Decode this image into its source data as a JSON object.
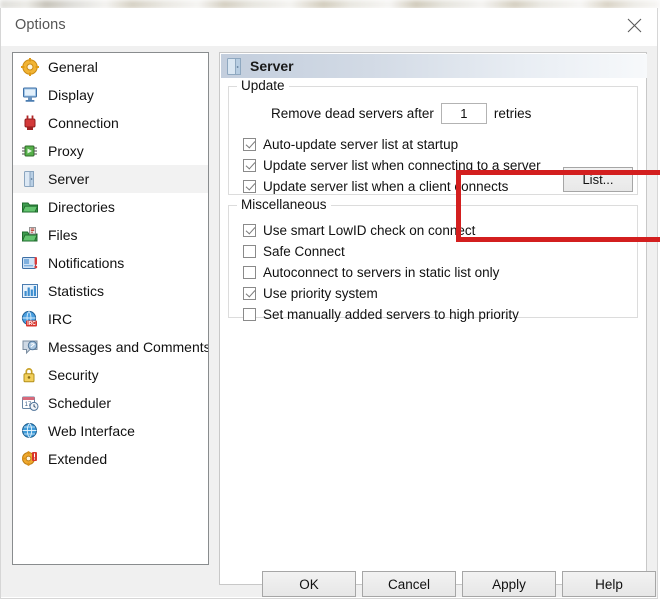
{
  "window": {
    "title": "Options",
    "close_icon": "close-icon"
  },
  "sidebar": {
    "items": [
      {
        "label": "General",
        "icon": "gear-icon",
        "selected": false
      },
      {
        "label": "Display",
        "icon": "monitor-icon",
        "selected": false
      },
      {
        "label": "Connection",
        "icon": "plug-icon",
        "selected": false
      },
      {
        "label": "Proxy",
        "icon": "proxy-icon",
        "selected": false
      },
      {
        "label": "Server",
        "icon": "server-door-icon",
        "selected": true
      },
      {
        "label": "Directories",
        "icon": "folder-green-icon",
        "selected": false
      },
      {
        "label": "Files",
        "icon": "files-icon",
        "selected": false
      },
      {
        "label": "Notifications",
        "icon": "notification-icon",
        "selected": false
      },
      {
        "label": "Statistics",
        "icon": "chart-bars-icon",
        "selected": false
      },
      {
        "label": "IRC",
        "icon": "irc-globe-icon",
        "selected": false
      },
      {
        "label": "Messages and Comments",
        "icon": "speech-bubble-icon",
        "selected": false
      },
      {
        "label": "Security",
        "icon": "padlock-icon",
        "selected": false
      },
      {
        "label": "Scheduler",
        "icon": "calendar-clock-icon",
        "selected": false
      },
      {
        "label": "Web Interface",
        "icon": "globe-icon",
        "selected": false
      },
      {
        "label": "Extended",
        "icon": "gear-alert-icon",
        "selected": false
      }
    ]
  },
  "panel": {
    "header": {
      "title": "Server",
      "icon": "server-door-icon"
    },
    "update_group": {
      "legend": "Update",
      "retries_prefix": "Remove dead servers after",
      "retries_value": "1",
      "retries_suffix": "retries",
      "list_button": "List...",
      "checkboxes": [
        {
          "label": "Auto-update server list at startup",
          "checked": true
        },
        {
          "label": "Update server list when connecting to a server",
          "checked": true
        },
        {
          "label": "Update server list when a client connects",
          "checked": true
        }
      ]
    },
    "misc_group": {
      "legend": "Miscellaneous",
      "checkboxes": [
        {
          "label": "Use smart LowID check on connect",
          "checked": true
        },
        {
          "label": "Safe Connect",
          "checked": false
        },
        {
          "label": "Autoconnect to servers in static list only",
          "checked": false
        },
        {
          "label": "Use priority system",
          "checked": true
        },
        {
          "label": "Set manually added servers to high priority",
          "checked": false
        }
      ]
    }
  },
  "annotation": {
    "color": "#d31f1f"
  },
  "footer": {
    "buttons": [
      {
        "id": "btn-ok",
        "label": "OK"
      },
      {
        "id": "btn-cancel",
        "label": "Cancel"
      },
      {
        "id": "btn-apply",
        "label": "Apply"
      },
      {
        "id": "btn-help",
        "label": "Help"
      }
    ]
  }
}
